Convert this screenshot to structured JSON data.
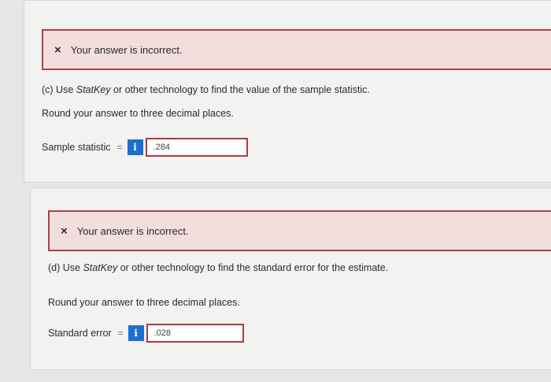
{
  "part_c": {
    "feedback": "Your answer is incorrect.",
    "question_prefix": "(c) Use ",
    "question_tool": "StatKey",
    "question_suffix": " or other technology to find the value of the sample statistic.",
    "instruction": "Round your answer to three decimal places.",
    "answer_label": "Sample statistic",
    "equals": "=",
    "info_glyph": "i",
    "answer_value": ".284"
  },
  "part_d": {
    "feedback": "Your answer is incorrect.",
    "question_prefix": "(d) Use ",
    "question_tool": "StatKey",
    "question_suffix": " or other technology to find the standard error for the estimate.",
    "instruction": "Round your answer to three decimal places.",
    "answer_label": "Standard error",
    "equals": "=",
    "info_glyph": "i",
    "answer_value": ".028"
  },
  "icons": {
    "incorrect": "×",
    "info": "info-icon"
  },
  "colors": {
    "error_border": "#b24040",
    "error_bg": "#f3dede",
    "info_blue": "#1c6fd1"
  }
}
